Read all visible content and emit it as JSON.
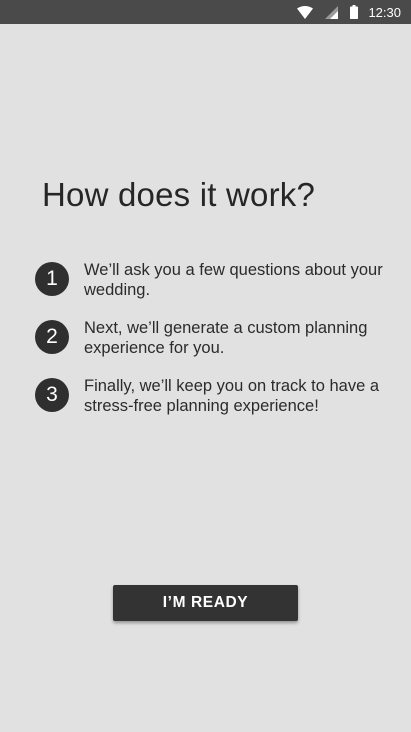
{
  "status_bar": {
    "time": "12:30",
    "icons": [
      "wifi-icon",
      "cell-signal-icon",
      "battery-icon"
    ]
  },
  "content": {
    "title": "How does it work?",
    "steps": [
      {
        "number": "1",
        "text": "We’ll ask you a few questions about your wedding."
      },
      {
        "number": "2",
        "text": "Next, we’ll generate a custom planning experience for you."
      },
      {
        "number": "3",
        "text": "Finally, we’ll keep you on track to have a stress-free planning experience!"
      }
    ],
    "ready_button": "I’M READY"
  },
  "colors": {
    "background": "#e1e1e1",
    "status_bar": "#4a4a4a",
    "badge": "#2f2f2f",
    "button": "#333333"
  }
}
